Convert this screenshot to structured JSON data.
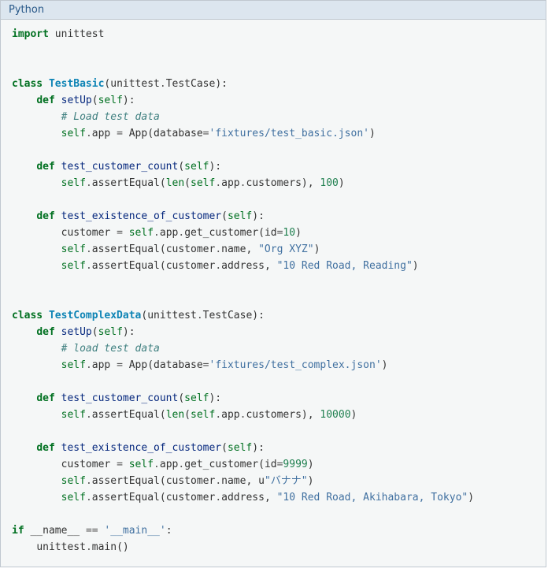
{
  "header": {
    "language": "Python"
  },
  "code": {
    "import_kw": "import",
    "unittest": "unittest",
    "class_kw": "class",
    "def_kw": "def",
    "if_kw": "if",
    "self": "self",
    "len": "len",
    "eq": "==",
    "assign": "=",
    "cls1": "TestBasic",
    "cls2": "TestComplexData",
    "base": "TestCase",
    "setUp": "setUp",
    "m_tcc": "test_customer_count",
    "m_teoc": "test_existence_of_customer",
    "attr_app": "app",
    "App": "App",
    "kw_database": "database",
    "fixture1": "'fixtures/test_basic.json'",
    "fixture2": "'fixtures/test_complex.json'",
    "cmt_load1": "# Load test data",
    "cmt_load2": "# load test data",
    "assertEqual": "assertEqual",
    "customers": "customers",
    "n100": "100",
    "n10000": "10000",
    "customer_var": "customer",
    "get_customer": "get_customer",
    "kw_id": "id",
    "id10": "10",
    "id9999": "9999",
    "attr_name": "name",
    "attr_address": "address",
    "org_xyz": "\"Org XYZ\"",
    "addr1": "\"10 Red Road, Reading\"",
    "u_prefix": "u",
    "banana": "\"バナナ\"",
    "addr2": "\"10 Red Road, Akihabara, Tokyo\"",
    "name_dunder": "__name__",
    "main_str": "'__main__'",
    "main": "main"
  }
}
